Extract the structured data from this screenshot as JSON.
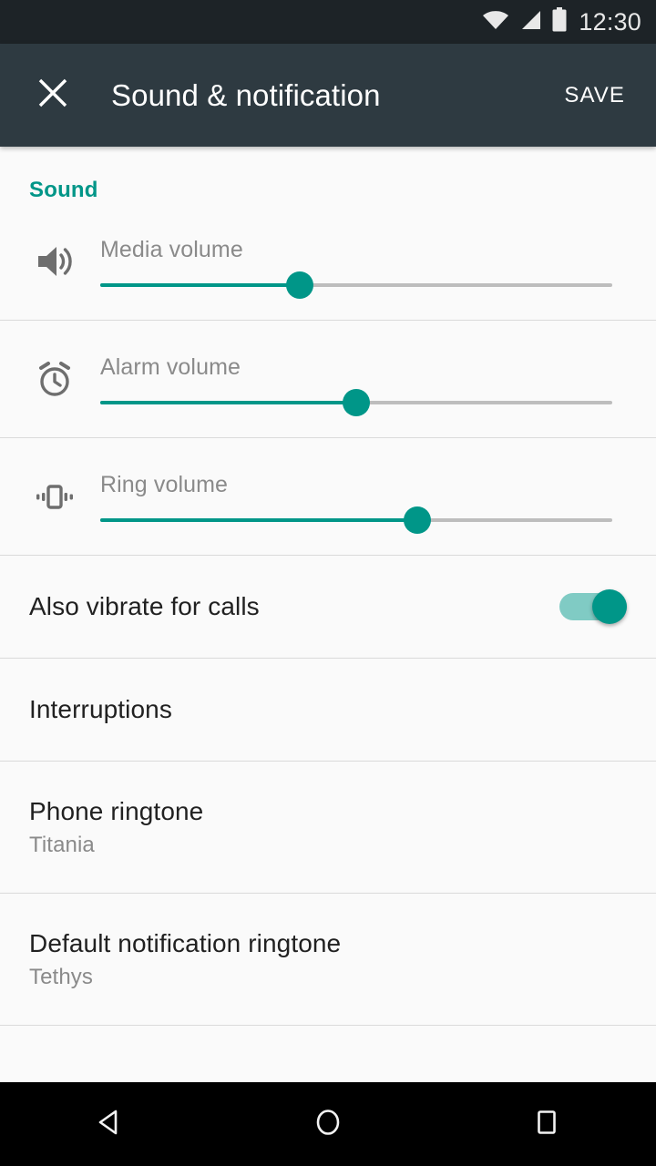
{
  "status_bar": {
    "time": "12:30",
    "icons": [
      "wifi-icon",
      "signal-icon",
      "battery-icon"
    ]
  },
  "toolbar": {
    "close_icon": "close-icon",
    "title": "Sound & notification",
    "save_label": "SAVE"
  },
  "colors": {
    "accent": "#009688",
    "accent_light": "#80CBC4",
    "toolbar_bg": "#2E3A41",
    "status_bg": "#1D2327",
    "page_bg": "#FAFAFA",
    "divider": "#DADADA",
    "primary_text": "#212121",
    "secondary_text": "#8A8A8A",
    "track_bg": "#BDBDBD"
  },
  "main": {
    "section_title": "Sound",
    "sliders": [
      {
        "label": "Media volume",
        "icon": "volume-up-icon",
        "value_percent": 39
      },
      {
        "label": "Alarm volume",
        "icon": "alarm-clock-icon",
        "value_percent": 50
      },
      {
        "label": "Ring volume",
        "icon": "vibration-icon",
        "value_percent": 62
      }
    ],
    "rows": [
      {
        "title": "Also vibrate for calls",
        "subtitle": "",
        "control": "toggle",
        "toggle_on": true
      },
      {
        "title": "Interruptions",
        "subtitle": "",
        "control": "none"
      },
      {
        "title": "Phone ringtone",
        "subtitle": "Titania",
        "control": "none"
      },
      {
        "title": "Default notification ringtone",
        "subtitle": "Tethys",
        "control": "none"
      }
    ]
  },
  "nav_bar": {
    "back": "back-icon",
    "home": "home-icon",
    "recents": "recents-icon"
  }
}
